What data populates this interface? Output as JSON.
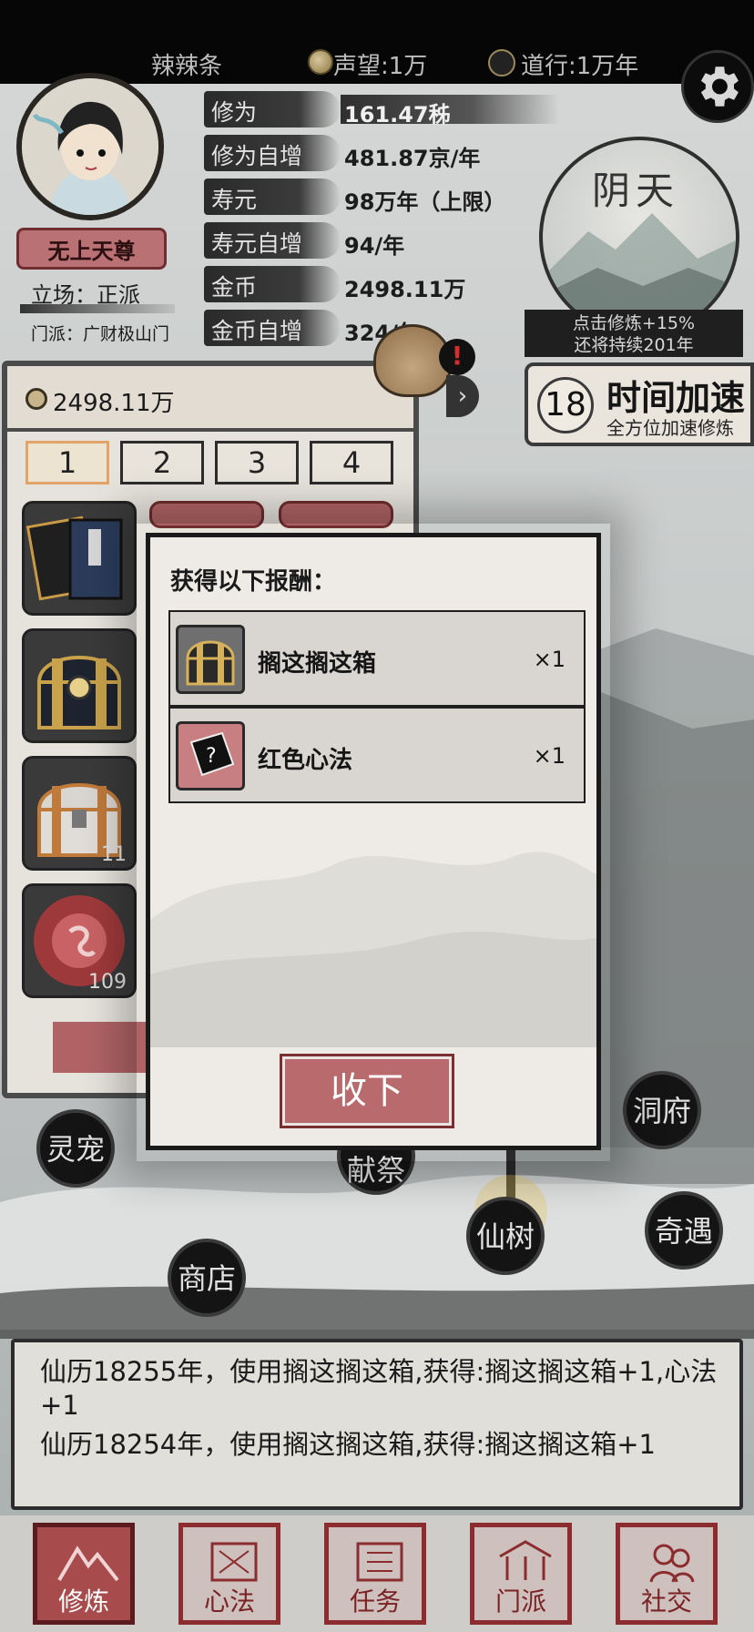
{
  "header": {
    "player_name": "辣辣条",
    "reputation": "声望:1万",
    "daoxing": "道行:1万年",
    "settings_icon": "gear-icon"
  },
  "profile": {
    "title": "无上天尊",
    "stance": "立场：正派",
    "sect": "门派：广财极山门"
  },
  "stats": [
    {
      "label": "修为",
      "value": "161.47秭"
    },
    {
      "label": "修为自增",
      "value": "481.87京/年"
    },
    {
      "label": "寿元",
      "value": "98万年（上限）"
    },
    {
      "label": "寿元自增",
      "value": "94/年"
    },
    {
      "label": "金币",
      "value": "2498.11万"
    },
    {
      "label": "金币自增",
      "value": "324/年"
    }
  ],
  "weather": {
    "name": "阴天",
    "info_line1": "点击修炼+15%",
    "info_line2": "还将持续201年"
  },
  "speed_up": {
    "count": "18",
    "title": "时间加速",
    "subtitle": "全方位加速修炼"
  },
  "bag": {
    "gold": "2498.11万",
    "tabs": [
      "1",
      "2",
      "3",
      "4"
    ],
    "slot_counts": [
      "11",
      "109"
    ],
    "alert": "!"
  },
  "reward_dialog": {
    "title": "获得以下报酬：",
    "items": [
      {
        "name": "搁这搁这箱",
        "qty": "×1",
        "icon": "treasure-chest-icon"
      },
      {
        "name": "红色心法",
        "qty": "×1",
        "icon": "mystery-book-icon"
      }
    ],
    "accept_label": "收下"
  },
  "map_buttons": {
    "pet": "灵宠",
    "shop": "商店",
    "tree": "仙树",
    "cave": "洞府",
    "adventure": "奇遇",
    "partial": "献祭"
  },
  "log": [
    "仙历18255年，使用搁这搁这箱,获得:搁这搁这箱+1,心法+1",
    "仙历18254年，使用搁这搁这箱,获得:搁这搁这箱+1"
  ],
  "nav": [
    {
      "label": "修炼",
      "active": true
    },
    {
      "label": "心法",
      "active": false
    },
    {
      "label": "任务",
      "active": false
    },
    {
      "label": "门派",
      "active": false
    },
    {
      "label": "社交",
      "active": false
    }
  ],
  "colors": {
    "accent_red": "#b86a6c",
    "seal_red": "#8c2c2e",
    "ink": "#1a1a1a"
  }
}
